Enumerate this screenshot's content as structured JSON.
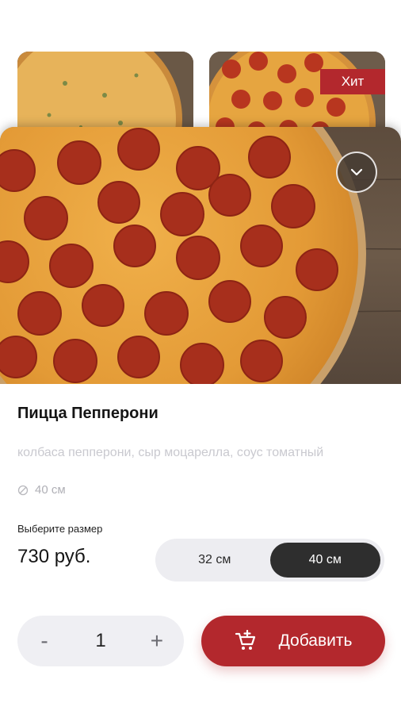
{
  "cards": {
    "badge": "Хит"
  },
  "product": {
    "title": "Пицца Пепперони",
    "description": "колбаса пепперони, сыр моцарелла, соус томатный",
    "size_info": "40 см",
    "choose_size_label": "Выберите размер",
    "price": "730 руб.",
    "sizes": [
      "32 см",
      "40 см"
    ],
    "selected_size": "40 см"
  },
  "cart": {
    "minus": "-",
    "quantity": "1",
    "plus": "+",
    "add_label": "Добавить"
  },
  "colors": {
    "accent": "#b3282d",
    "dark_toggle": "#2e2e2e"
  }
}
